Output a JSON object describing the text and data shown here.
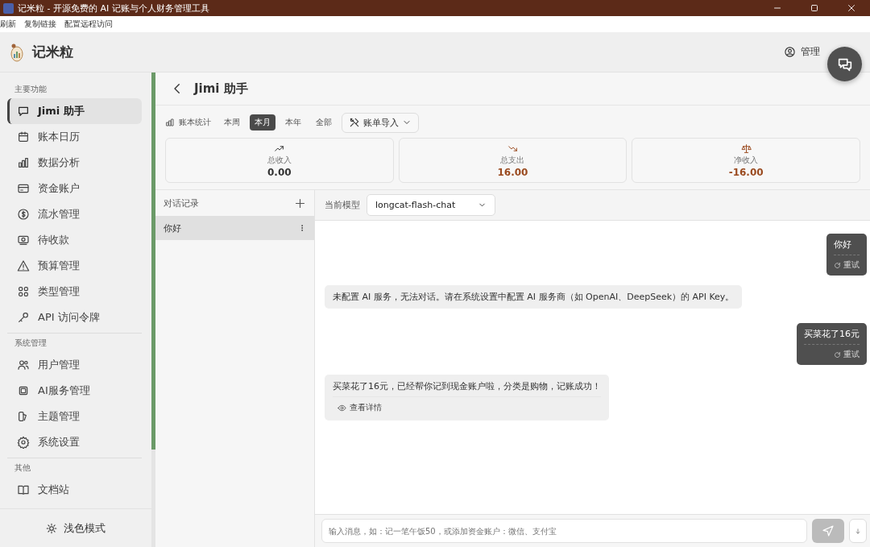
{
  "window": {
    "title": "记米粒 - 开源免费的 AI 记账与个人财务管理工具"
  },
  "menu": [
    "刷新",
    "复制链接",
    "配置远程访问"
  ],
  "app": {
    "name": "记米粒",
    "user_menu": "管理"
  },
  "sidebar": {
    "sections": [
      {
        "title": "主要功能",
        "items": [
          {
            "label": "Jimi 助手",
            "selected": true
          },
          {
            "label": "账本日历",
            "selected": false
          },
          {
            "label": "数据分析",
            "selected": false
          },
          {
            "label": "资金账户",
            "selected": false
          },
          {
            "label": "流水管理",
            "selected": false
          },
          {
            "label": "待收款",
            "selected": false
          },
          {
            "label": "预算管理",
            "selected": false
          },
          {
            "label": "类型管理",
            "selected": false
          },
          {
            "label": "API 访问令牌",
            "selected": false
          }
        ]
      },
      {
        "title": "系统管理",
        "items": [
          {
            "label": "用户管理",
            "selected": false
          },
          {
            "label": "AI服务管理",
            "selected": false
          },
          {
            "label": "主题管理",
            "selected": false
          },
          {
            "label": "系统设置",
            "selected": false
          }
        ]
      },
      {
        "title": "其他",
        "items": [
          {
            "label": "文档站",
            "selected": false
          }
        ]
      }
    ],
    "theme_toggle": "浅色模式"
  },
  "page": {
    "title": "Jimi 助手"
  },
  "stats": {
    "label": "账本统计",
    "periods": [
      {
        "label": "本周",
        "selected": false
      },
      {
        "label": "本月",
        "selected": true
      },
      {
        "label": "本年",
        "selected": false
      },
      {
        "label": "全部",
        "selected": false
      }
    ],
    "import_button": "账单导入",
    "cards": [
      {
        "kind": "income",
        "label": "总收入",
        "value": "0.00"
      },
      {
        "kind": "expense",
        "label": "总支出",
        "value": "16.00"
      },
      {
        "kind": "net",
        "label": "净收入",
        "value": "-16.00"
      }
    ]
  },
  "conversations": {
    "title": "对话记录",
    "items": [
      {
        "title": "你好",
        "selected": true
      }
    ]
  },
  "chat": {
    "model_label": "当前模型",
    "model": "longcat-flash-chat",
    "messages": [
      {
        "kind": "user",
        "text": "你好",
        "action": "重试"
      },
      {
        "kind": "assistant",
        "text": "未配置 AI 服务，无法对话。请在系统设置中配置 AI 服务商（如 OpenAI、DeepSeek）的 API Key。"
      },
      {
        "kind": "user",
        "text": "买菜花了16元",
        "action": "重试"
      },
      {
        "kind": "assistant",
        "text": "买菜花了16元，已经帮你记到现金账户啦，分类是购物，记账成功！",
        "action": "查看详情"
      }
    ],
    "input_placeholder": "输入消息，如：记一笔午饭50，或添加资金账户：微信、支付宝"
  }
}
